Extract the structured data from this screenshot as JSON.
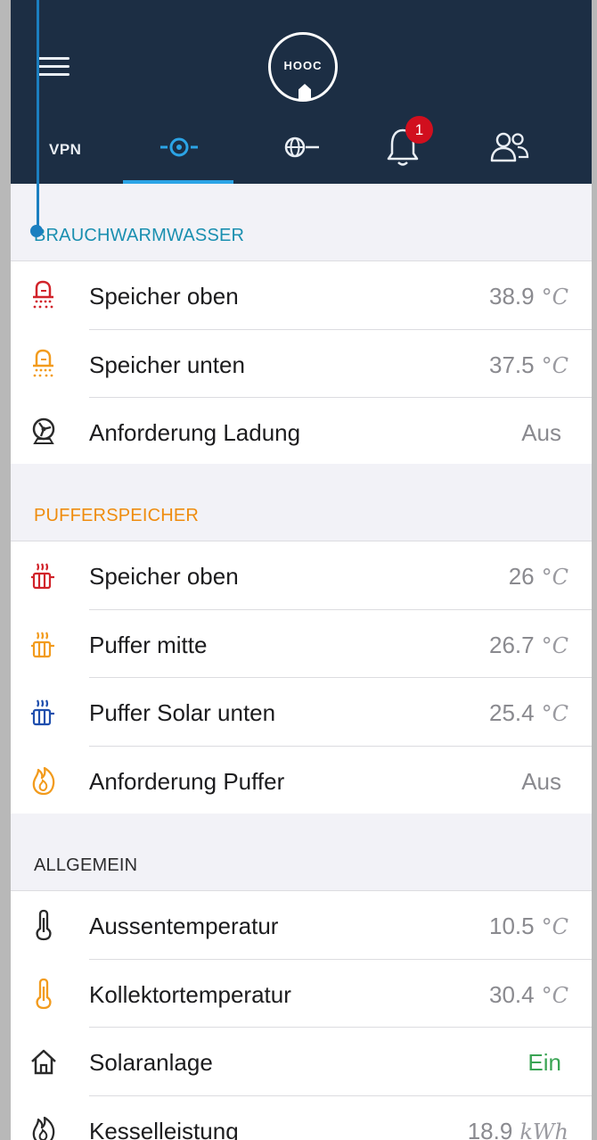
{
  "header": {
    "logo_text": "HOOC",
    "tabs": [
      {
        "label": "VPN",
        "icon": "vpn-text"
      },
      {
        "label": "",
        "icon": "local-connection-icon",
        "active": true
      },
      {
        "label": "",
        "icon": "globe-connection-icon"
      },
      {
        "label": "",
        "icon": "bell-icon",
        "badge": "1"
      },
      {
        "label": "",
        "icon": "users-icon"
      }
    ]
  },
  "colors": {
    "topbar": "#1c2e44",
    "accent_blue": "#2ba4e6",
    "section_blue": "#1a8fb0",
    "section_orange": "#ef8c0e",
    "icon_red": "#d1232a",
    "icon_orange": "#f29b1d",
    "icon_blue": "#1f4fae",
    "value_green": "#3aa454"
  },
  "sections": [
    {
      "title": "BRAUCHWARMWASSER",
      "rows": [
        {
          "icon": "shower-red-icon",
          "label": "Speicher oben",
          "value": "38.9",
          "unit": "°C"
        },
        {
          "icon": "shower-orange-icon",
          "label": "Speicher unten",
          "value": "37.5",
          "unit": "°C"
        },
        {
          "icon": "pump-icon",
          "label": "Anforderung Ladung",
          "value": "Aus",
          "unit": ""
        }
      ]
    },
    {
      "title": "PUFFERSPEICHER",
      "rows": [
        {
          "icon": "radiator-red-icon",
          "label": "Speicher oben",
          "value": "26",
          "unit": "°C"
        },
        {
          "icon": "radiator-orange-icon",
          "label": "Puffer mitte",
          "value": "26.7",
          "unit": "°C"
        },
        {
          "icon": "radiator-blue-icon",
          "label": "Puffer Solar unten",
          "value": "25.4",
          "unit": "°C"
        },
        {
          "icon": "flame-orange-icon",
          "label": "Anforderung Puffer",
          "value": "Aus",
          "unit": ""
        }
      ]
    },
    {
      "title": "ALLGEMEIN",
      "rows": [
        {
          "icon": "thermometer-icon",
          "label": "Aussentemperatur",
          "value": "10.5",
          "unit": "°C"
        },
        {
          "icon": "thermometer-orange-icon",
          "label": "Kollektortemperatur",
          "value": "30.4",
          "unit": "°C"
        },
        {
          "icon": "home-icon",
          "label": "Solaranlage",
          "value": "Ein",
          "unit": ""
        },
        {
          "icon": "flame-icon",
          "label": "Kesselleistung",
          "value": "18.9",
          "unit": "kWh"
        }
      ]
    }
  ]
}
